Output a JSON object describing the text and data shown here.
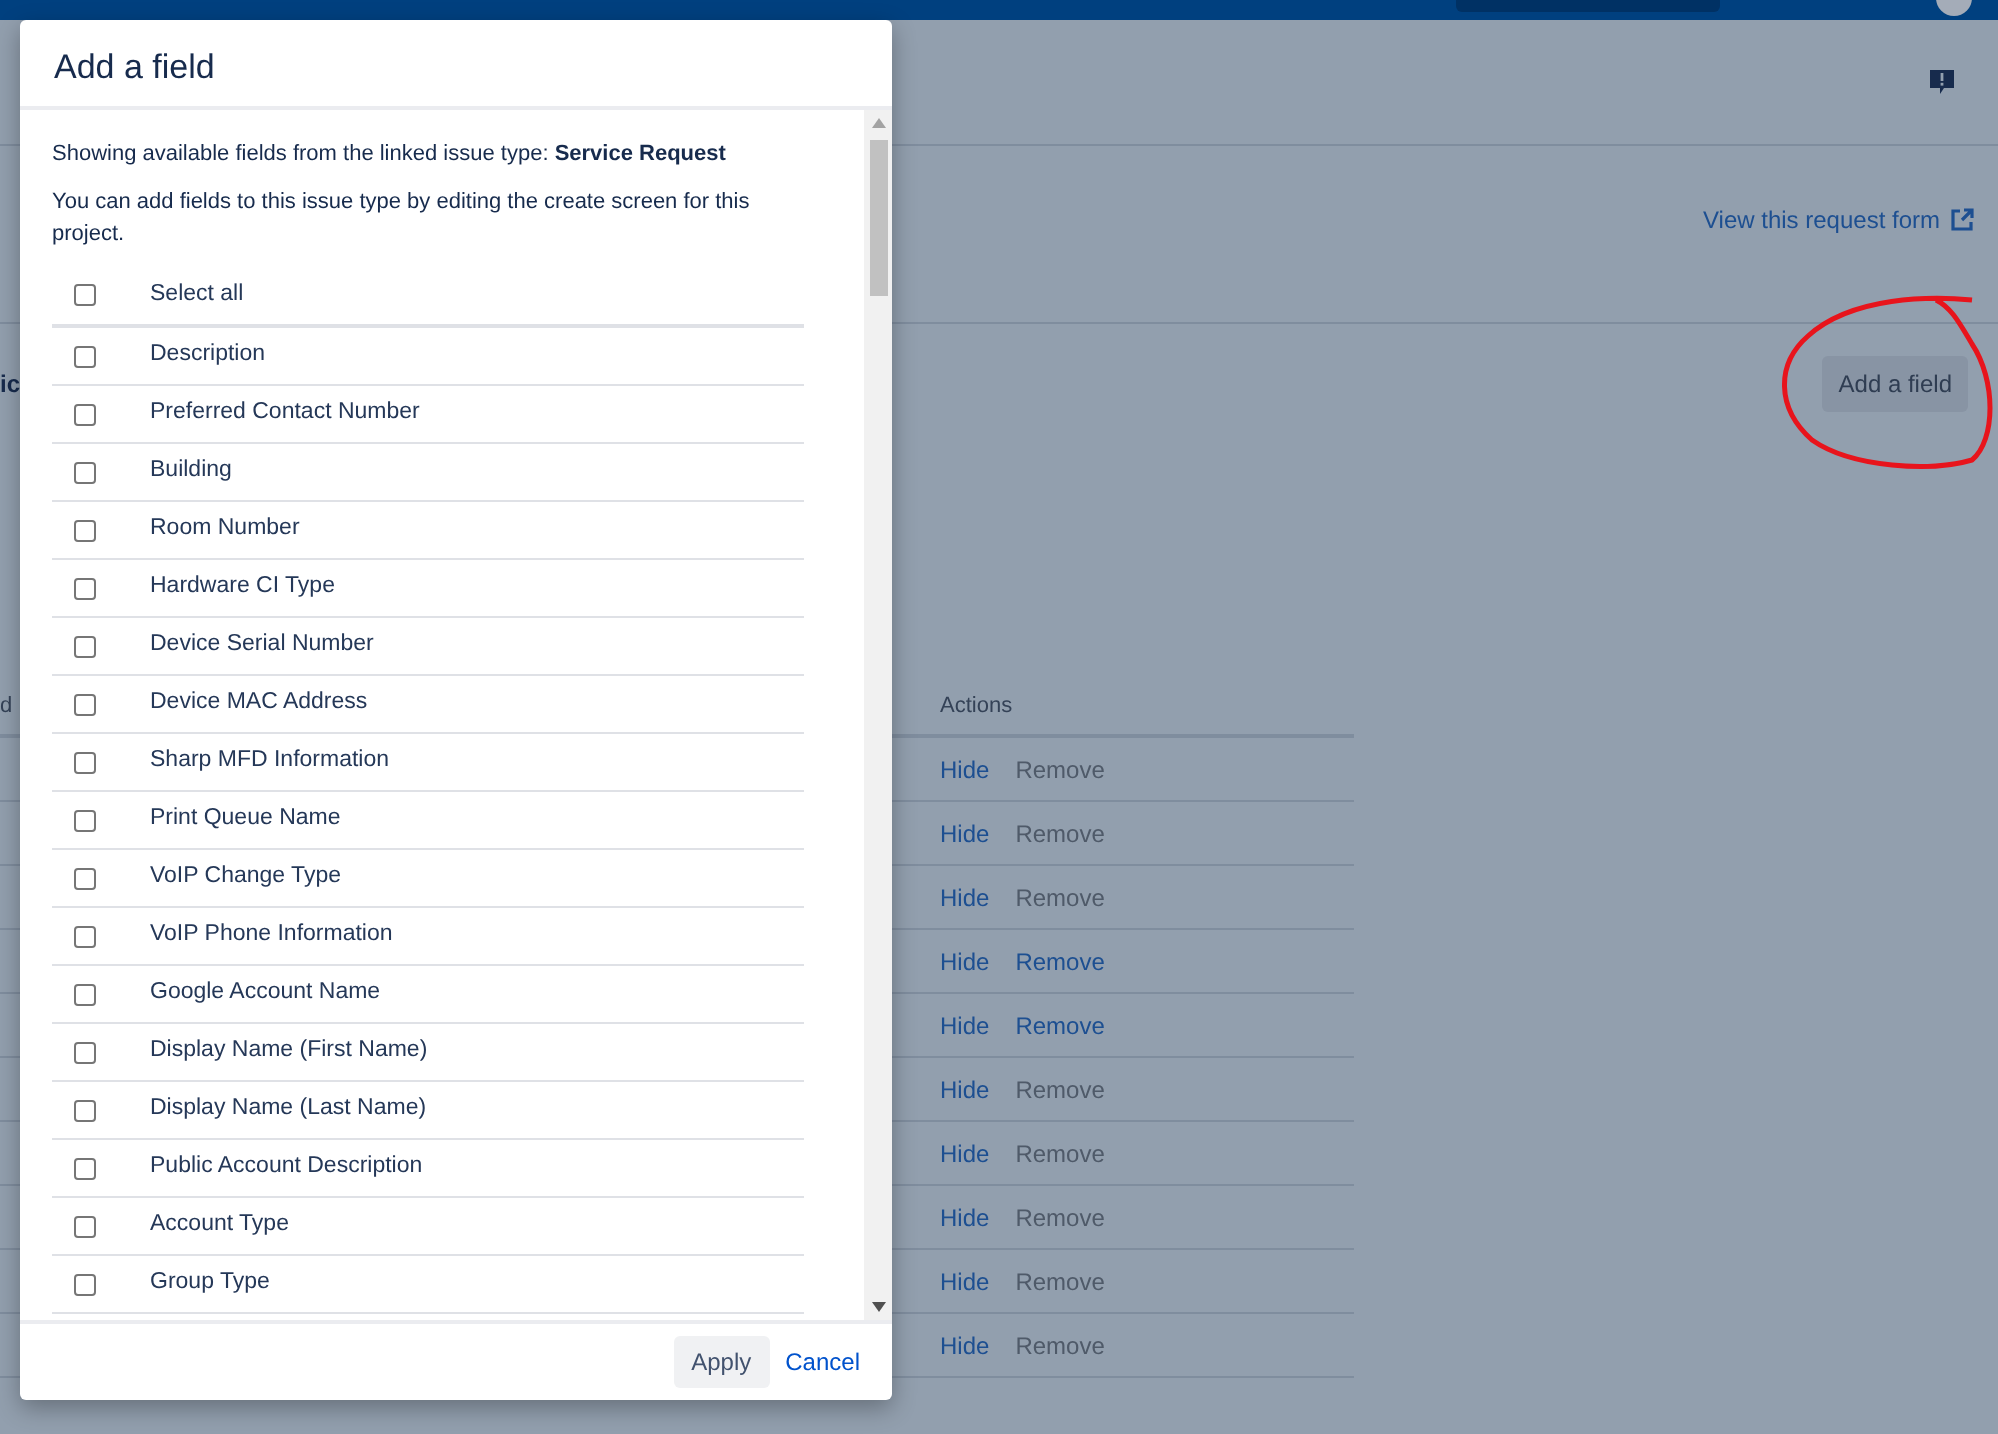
{
  "page": {
    "left_cut_text": "ic",
    "view_link": "View this request form",
    "add_button": "Add a field",
    "table": {
      "header_cut": "d",
      "actions_header": "Actions",
      "rows": [
        {
          "hide": "Hide",
          "remove": "Remove",
          "remove_disabled": true
        },
        {
          "hide": "Hide",
          "remove": "Remove",
          "remove_disabled": true
        },
        {
          "hide": "Hide",
          "remove": "Remove",
          "remove_disabled": true
        },
        {
          "hide": "Hide",
          "remove": "Remove",
          "remove_disabled": false
        },
        {
          "hide": "Hide",
          "remove": "Remove",
          "remove_disabled": false
        },
        {
          "hide": "Hide",
          "remove": "Remove",
          "remove_disabled": true
        },
        {
          "hide": "Hide",
          "remove": "Remove",
          "remove_disabled": true
        },
        {
          "hide": "Hide",
          "remove": "Remove",
          "remove_disabled": true
        },
        {
          "hide": "Hide",
          "remove": "Remove",
          "remove_disabled": true
        },
        {
          "hide": "Hide",
          "remove": "Remove",
          "remove_disabled": true
        }
      ]
    }
  },
  "dialog": {
    "title": "Add a field",
    "intro": "Showing available fields from the linked issue type: **Service Request**",
    "note": "You can add fields to this issue type by editing the create screen for this project.",
    "select_all": {
      "label": "Select all",
      "checked": false
    },
    "fields": [
      {
        "label": "Description",
        "checked": false
      },
      {
        "label": "Preferred Contact Number",
        "checked": false
      },
      {
        "label": "Building",
        "checked": false
      },
      {
        "label": "Room Number",
        "checked": false
      },
      {
        "label": "Hardware CI Type",
        "checked": false
      },
      {
        "label": "Device Serial Number",
        "checked": false
      },
      {
        "label": "Device MAC Address",
        "checked": false
      },
      {
        "label": "Sharp MFD Information",
        "checked": false
      },
      {
        "label": "Print Queue Name",
        "checked": false
      },
      {
        "label": "VoIP Change Type",
        "checked": false
      },
      {
        "label": "VoIP Phone Information",
        "checked": false
      },
      {
        "label": "Google Account Name",
        "checked": false
      },
      {
        "label": "Display Name (First Name)",
        "checked": false
      },
      {
        "label": "Display Name (Last Name)",
        "checked": false
      },
      {
        "label": "Public Account Description",
        "checked": false
      },
      {
        "label": "Account Type",
        "checked": false
      },
      {
        "label": "Group Type",
        "checked": false
      }
    ],
    "apply": "Apply",
    "cancel": "Cancel"
  }
}
